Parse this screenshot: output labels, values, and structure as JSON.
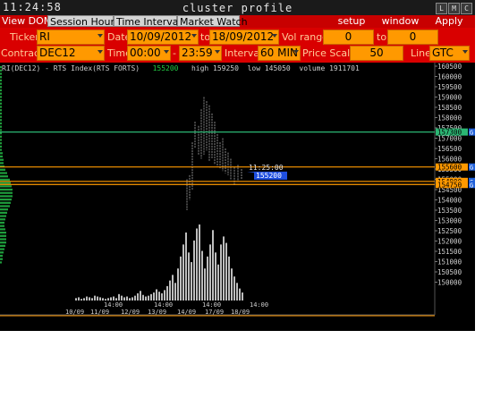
{
  "titlebar": {
    "clock": "11:24:58",
    "title": "cluster profile",
    "btn_min": "L",
    "btn_max": "M",
    "btn_close": "C"
  },
  "menu": {
    "tabs": [
      "View DOM",
      "Session Hours",
      "Time Interval",
      "Market Watch"
    ],
    "setup": "setup",
    "window": "window",
    "apply": "Apply"
  },
  "controls": {
    "ticker_label": "Ticker",
    "ticker": "RI",
    "date_label": "Date",
    "date_from": "10/09/2012",
    "to_label": "to",
    "date_to": "18/09/2012",
    "vol_range_label": "Vol range",
    "vol_from": "0",
    "vol_to_label": "to",
    "vol_to": "0",
    "contract_label": "Contract",
    "contract": "DEC12",
    "time_label": "Time",
    "time_from": "00:00",
    "time_to_label": "-",
    "time_to": "23:59",
    "interval_label": "Interval",
    "interval": "60 MIN",
    "price_scale_label": "Price Scale",
    "price_scale": "50",
    "line_label": "Line",
    "line": "GTC"
  },
  "chart_header": {
    "symbol": "RI(DEC12) - RTS Index(RTS FORTS)",
    "last": "155200",
    "high": "high 159250",
    "low": "low 145050",
    "volume": "volume 1911701"
  },
  "chart_data": {
    "type": "bar",
    "title": "RI(DEC12) - RTS Index(RTS FORTS)",
    "price_axis": [
      "160500",
      "160000",
      "159500",
      "159000",
      "158500",
      "158000",
      "157500",
      "157000",
      "156500",
      "156000",
      "155500",
      "155000",
      "154500",
      "154000",
      "153500",
      "153000",
      "152500",
      "152000",
      "151500",
      "151000",
      "150500",
      "150000"
    ],
    "time_axis_top": [
      "14:00",
      "14:00",
      "14:00",
      "14:00"
    ],
    "time_axis_bottom": [
      "10/09",
      "11/09",
      "12/09",
      "13/09",
      "14/09",
      "17/09",
      "18/09"
    ],
    "cursor_time": "11:25:00",
    "cursor_price": "155200",
    "levels": [
      {
        "label": "157300",
        "color": "#2bb673"
      },
      {
        "label": "155600",
        "color": "#ff9900"
      },
      {
        "label": "154900",
        "color": "#ff9900"
      },
      {
        "label": "154750",
        "color": "#ff9900"
      }
    ],
    "level_marker": "G",
    "volume_bars": [
      3,
      4,
      2,
      3,
      5,
      4,
      3,
      6,
      5,
      4,
      3,
      2,
      3,
      4,
      5,
      3,
      8,
      6,
      4,
      5,
      3,
      4,
      6,
      9,
      12,
      7,
      5,
      6,
      8,
      10,
      14,
      11,
      9,
      13,
      18,
      25,
      32,
      22,
      40,
      55,
      70,
      85,
      60,
      48,
      75,
      90,
      95,
      62,
      40,
      55,
      70,
      88,
      60,
      45,
      70,
      80,
      72,
      55,
      40,
      30,
      22,
      15,
      10
    ]
  }
}
